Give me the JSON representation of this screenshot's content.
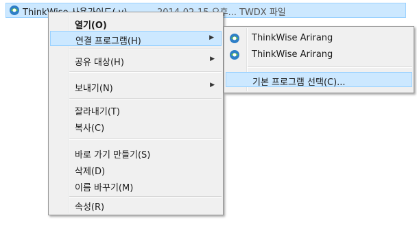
{
  "file_row": {
    "name": "ThinkWise 사용가이드(.v)",
    "date": "2014-02-15 오후...",
    "type": "TWDX 파일",
    "icon": "thinkwise-app-icon",
    "highlight_color": "#cce8ff"
  },
  "context_menu": {
    "items": [
      {
        "label": "열기(O)",
        "bold": true
      },
      {
        "label": "연결 프로그램(H)",
        "submenu": true,
        "highlighted": true
      },
      {
        "label": "공유 대상(H)",
        "submenu": true
      },
      {
        "label": "보내기(N)",
        "submenu": true
      },
      {
        "label": "잘라내기(T)"
      },
      {
        "label": "복사(C)"
      },
      {
        "label": "바로 가기 만들기(S)"
      },
      {
        "label": "삭제(D)"
      },
      {
        "label": "이름 바꾸기(M)"
      },
      {
        "label": "속성(R)"
      }
    ],
    "submenu_arrow": "▶"
  },
  "open_with_submenu": {
    "items": [
      {
        "label": "ThinkWise Arirang",
        "icon": "thinkwise-app-icon"
      },
      {
        "label": "ThinkWise Arirang",
        "icon": "thinkwise-app-icon"
      },
      {
        "label": "기본 프로그램 선택(C)...",
        "highlighted": true
      }
    ]
  },
  "colors": {
    "menu_bg": "#f0f0f0",
    "hover_bg": "#cce8ff",
    "hover_border": "#99d1ff"
  }
}
